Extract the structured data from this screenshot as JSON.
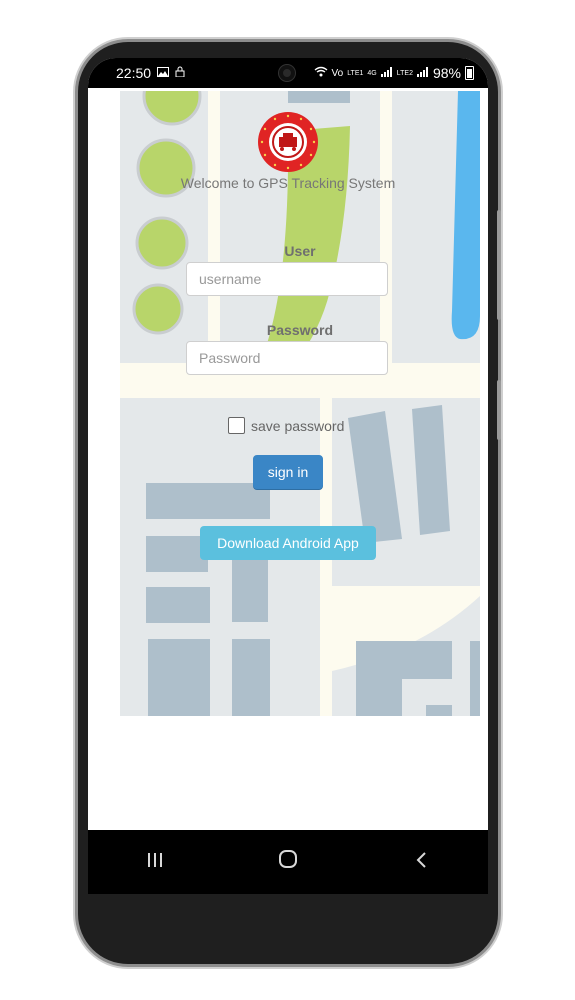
{
  "status_bar": {
    "time": "22:50",
    "network_left": "Vo",
    "network_4g": "4G",
    "network_lte1": "LTE1",
    "network_lte2": "LTE2",
    "battery": "98%"
  },
  "login": {
    "welcome": "Welcome to GPS Tracking System",
    "user_label": "User",
    "username_placeholder": "username",
    "password_label": "Password",
    "password_placeholder": "Password",
    "save_password_label": "save password",
    "sign_in_label": "sign in",
    "download_label": "Download Android App"
  },
  "colors": {
    "primary_button": "#3a86c6",
    "info_button": "#5bc0de",
    "map_green": "#b8d56a",
    "map_water": "#5ab7ee",
    "map_block": "#aebfcb"
  },
  "icons": {
    "logo": "indian-railways-logo",
    "nav_recents": "recents-icon",
    "nav_home": "home-icon",
    "nav_back": "back-icon"
  }
}
